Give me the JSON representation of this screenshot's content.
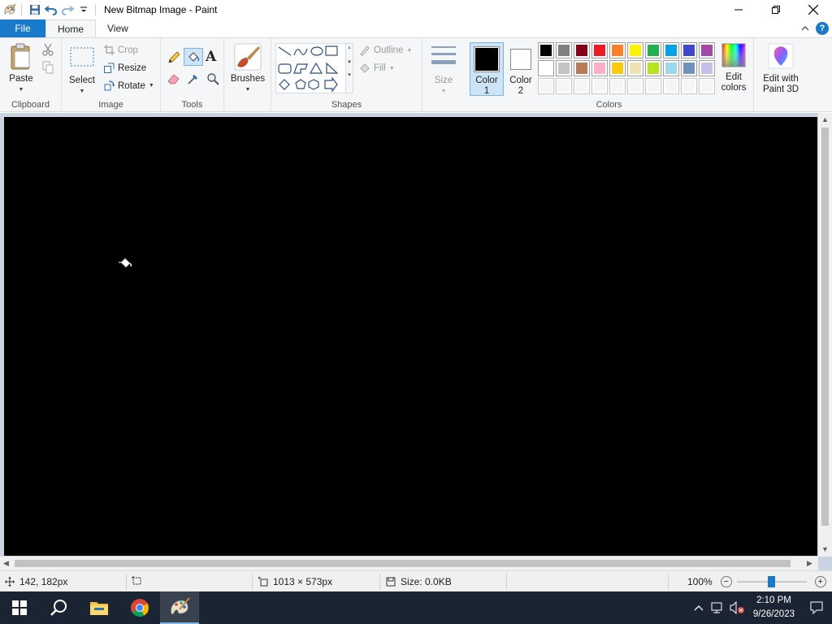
{
  "window": {
    "title": "New Bitmap Image - Paint",
    "quick_access": [
      "paint-app-icon",
      "save-icon",
      "undo-icon",
      "redo-icon",
      "customize-qat-icon"
    ],
    "controls": [
      "minimize",
      "restore",
      "close"
    ]
  },
  "tabs": {
    "file": "File",
    "home": "Home",
    "view": "View",
    "active": "Home"
  },
  "ribbon": {
    "clipboard": {
      "label": "Clipboard",
      "paste": "Paste",
      "cut_icon": "scissors-icon",
      "copy_icon": "copy-icon"
    },
    "image": {
      "label": "Image",
      "select": "Select",
      "crop": "Crop",
      "resize": "Resize",
      "rotate": "Rotate"
    },
    "tools": {
      "label": "Tools",
      "items": [
        "pencil-icon",
        "fill-bucket-icon",
        "text-icon",
        "eraser-icon",
        "color-picker-icon",
        "magnifier-icon"
      ],
      "active": "fill-bucket-icon"
    },
    "brushes": {
      "label": "Brushes"
    },
    "shapes": {
      "label": "Shapes",
      "outline": "Outline",
      "fill": "Fill"
    },
    "size": {
      "label": "Size"
    },
    "colors": {
      "label": "Colors",
      "color1_label": "Color",
      "color1_num": "1",
      "color2_label": "Color",
      "color2_num": "2",
      "color1": "#000000",
      "color2": "#ffffff",
      "edit_colors_line1": "Edit",
      "edit_colors_line2": "colors",
      "paint3d_line1": "Edit with",
      "paint3d_line2": "Paint 3D",
      "palette_row1": [
        "#000000",
        "#7f7f7f",
        "#880015",
        "#ed1c24",
        "#ff7f27",
        "#fff200",
        "#22b14c",
        "#00a2e8",
        "#3f48cc",
        "#a349a4"
      ],
      "palette_row2": [
        "#ffffff",
        "#c3c3c3",
        "#b97a57",
        "#ffaec9",
        "#ffc90e",
        "#efe4b0",
        "#b5e61d",
        "#99d9ea",
        "#7092be",
        "#c8bfe7"
      ],
      "palette_row3": [
        "#f5f5f5",
        "#f5f5f5",
        "#f5f5f5",
        "#f5f5f5",
        "#f5f5f5",
        "#f5f5f5",
        "#f5f5f5",
        "#f5f5f5",
        "#f5f5f5",
        "#f5f5f5"
      ]
    }
  },
  "canvas": {
    "background": "#000000"
  },
  "status": {
    "cursor_pos": "142, 182px",
    "canvas_size": "1013 × 573px",
    "file_size": "Size: 0.0KB",
    "zoom": "100%"
  },
  "taskbar": {
    "apps": [
      "start-icon",
      "search-icon",
      "file-explorer-icon",
      "chrome-icon",
      "paint-icon"
    ],
    "active_app": "paint-icon",
    "time": "2:10 PM",
    "date": "9/26/2023"
  }
}
